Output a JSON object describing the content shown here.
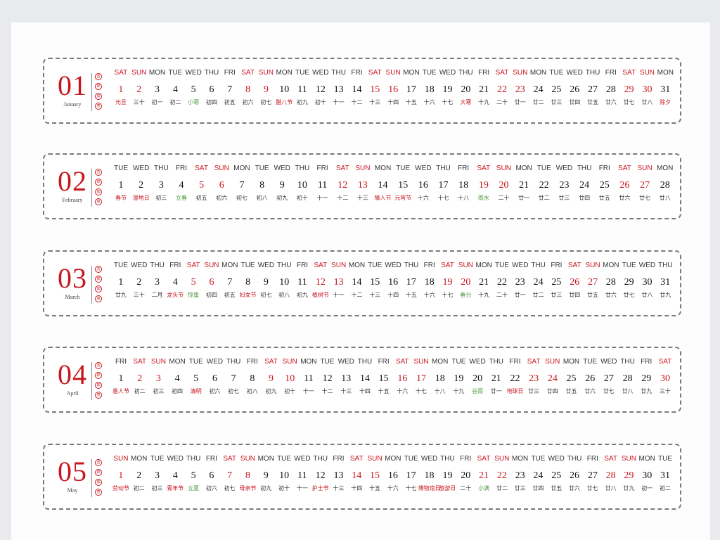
{
  "colors": {
    "accent": "#c8161d",
    "solar_term": "#4a9a3a",
    "text": "#111111",
    "border": "#7a7a7a"
  },
  "seal_text": [
    "吉",
    "祥",
    "如",
    "意"
  ],
  "months": [
    {
      "number": "01",
      "name": "January",
      "days": [
        {
          "w": "SAT",
          "d": "1",
          "l": "元旦",
          "lt": "fest",
          "we": true
        },
        {
          "w": "SUN",
          "d": "2",
          "l": "三十",
          "we": true
        },
        {
          "w": "MON",
          "d": "3",
          "l": "初一"
        },
        {
          "w": "TUE",
          "d": "4",
          "l": "初二"
        },
        {
          "w": "WED",
          "d": "5",
          "l": "小寒",
          "lt": "term"
        },
        {
          "w": "THU",
          "d": "6",
          "l": "初四"
        },
        {
          "w": "FRI",
          "d": "7",
          "l": "初五"
        },
        {
          "w": "SAT",
          "d": "8",
          "l": "初六",
          "we": true
        },
        {
          "w": "SUN",
          "d": "9",
          "l": "初七",
          "we": true
        },
        {
          "w": "MON",
          "d": "10",
          "l": "腊八节",
          "lt": "fest"
        },
        {
          "w": "TUE",
          "d": "11",
          "l": "初九"
        },
        {
          "w": "WED",
          "d": "12",
          "l": "初十"
        },
        {
          "w": "THU",
          "d": "13",
          "l": "十一"
        },
        {
          "w": "FRI",
          "d": "14",
          "l": "十二"
        },
        {
          "w": "SAT",
          "d": "15",
          "l": "十三",
          "we": true
        },
        {
          "w": "SUN",
          "d": "16",
          "l": "十四",
          "we": true
        },
        {
          "w": "MON",
          "d": "17",
          "l": "十五"
        },
        {
          "w": "TUE",
          "d": "18",
          "l": "十六"
        },
        {
          "w": "WED",
          "d": "19",
          "l": "十七"
        },
        {
          "w": "THU",
          "d": "20",
          "l": "大寒",
          "lt": "fest"
        },
        {
          "w": "FRI",
          "d": "21",
          "l": "十九"
        },
        {
          "w": "SAT",
          "d": "22",
          "l": "二十",
          "we": true
        },
        {
          "w": "SUN",
          "d": "23",
          "l": "廿一",
          "we": true
        },
        {
          "w": "MON",
          "d": "24",
          "l": "廿二"
        },
        {
          "w": "TUE",
          "d": "25",
          "l": "廿三"
        },
        {
          "w": "WED",
          "d": "26",
          "l": "廿四"
        },
        {
          "w": "THU",
          "d": "27",
          "l": "廿五"
        },
        {
          "w": "FRI",
          "d": "28",
          "l": "廿六"
        },
        {
          "w": "SAT",
          "d": "29",
          "l": "廿七",
          "we": true
        },
        {
          "w": "SUN",
          "d": "30",
          "l": "廿八",
          "we": true
        },
        {
          "w": "MON",
          "d": "31",
          "l": "除夕",
          "lt": "fest"
        }
      ]
    },
    {
      "number": "02",
      "name": "February",
      "days": [
        {
          "w": "TUE",
          "d": "1",
          "l": "春节",
          "lt": "fest"
        },
        {
          "w": "WED",
          "d": "2",
          "l": "湿地日",
          "lt": "fest"
        },
        {
          "w": "THU",
          "d": "3",
          "l": "初三"
        },
        {
          "w": "FRI",
          "d": "4",
          "l": "立春",
          "lt": "term"
        },
        {
          "w": "SAT",
          "d": "5",
          "l": "初五",
          "we": true
        },
        {
          "w": "SUN",
          "d": "6",
          "l": "初六",
          "we": true
        },
        {
          "w": "MON",
          "d": "7",
          "l": "初七"
        },
        {
          "w": "TUE",
          "d": "8",
          "l": "初八"
        },
        {
          "w": "WED",
          "d": "9",
          "l": "初九"
        },
        {
          "w": "THU",
          "d": "10",
          "l": "初十"
        },
        {
          "w": "FRI",
          "d": "11",
          "l": "十一"
        },
        {
          "w": "SAT",
          "d": "12",
          "l": "十二",
          "we": true
        },
        {
          "w": "SUN",
          "d": "13",
          "l": "十三",
          "we": true
        },
        {
          "w": "MON",
          "d": "14",
          "l": "情人节",
          "lt": "fest"
        },
        {
          "w": "TUE",
          "d": "15",
          "l": "元宵节",
          "lt": "fest"
        },
        {
          "w": "WED",
          "d": "16",
          "l": "十六"
        },
        {
          "w": "THU",
          "d": "17",
          "l": "十七"
        },
        {
          "w": "FRI",
          "d": "18",
          "l": "十八"
        },
        {
          "w": "SAT",
          "d": "19",
          "l": "雨水",
          "lt": "term",
          "we": true
        },
        {
          "w": "SUN",
          "d": "20",
          "l": "二十",
          "we": true
        },
        {
          "w": "MON",
          "d": "21",
          "l": "廿一"
        },
        {
          "w": "TUE",
          "d": "22",
          "l": "廿二"
        },
        {
          "w": "WED",
          "d": "23",
          "l": "廿三"
        },
        {
          "w": "THU",
          "d": "24",
          "l": "廿四"
        },
        {
          "w": "FRI",
          "d": "25",
          "l": "廿五"
        },
        {
          "w": "SAT",
          "d": "26",
          "l": "廿六",
          "we": true
        },
        {
          "w": "SUN",
          "d": "27",
          "l": "廿七",
          "we": true
        },
        {
          "w": "MON",
          "d": "28",
          "l": "廿八"
        }
      ]
    },
    {
      "number": "03",
      "name": "March",
      "days": [
        {
          "w": "TUE",
          "d": "1",
          "l": "廿九"
        },
        {
          "w": "WED",
          "d": "2",
          "l": "三十"
        },
        {
          "w": "THU",
          "d": "3",
          "l": "二月"
        },
        {
          "w": "FRI",
          "d": "4",
          "l": "龙头节",
          "lt": "fest"
        },
        {
          "w": "SAT",
          "d": "5",
          "l": "惊蛰",
          "lt": "term",
          "we": true
        },
        {
          "w": "SUN",
          "d": "6",
          "l": "初四",
          "we": true
        },
        {
          "w": "MON",
          "d": "7",
          "l": "初五"
        },
        {
          "w": "TUE",
          "d": "8",
          "l": "妇女节",
          "lt": "fest"
        },
        {
          "w": "WED",
          "d": "9",
          "l": "初七"
        },
        {
          "w": "THU",
          "d": "10",
          "l": "初八"
        },
        {
          "w": "FRI",
          "d": "11",
          "l": "初九"
        },
        {
          "w": "SAT",
          "d": "12",
          "l": "植树节",
          "lt": "fest",
          "we": true
        },
        {
          "w": "SUN",
          "d": "13",
          "l": "十一",
          "we": true
        },
        {
          "w": "MON",
          "d": "14",
          "l": "十二"
        },
        {
          "w": "TUE",
          "d": "15",
          "l": "十三"
        },
        {
          "w": "WED",
          "d": "16",
          "l": "十四"
        },
        {
          "w": "THU",
          "d": "17",
          "l": "十五"
        },
        {
          "w": "FRI",
          "d": "18",
          "l": "十六"
        },
        {
          "w": "SAT",
          "d": "19",
          "l": "十七",
          "we": true
        },
        {
          "w": "SUN",
          "d": "20",
          "l": "春分",
          "lt": "term",
          "we": true
        },
        {
          "w": "MON",
          "d": "21",
          "l": "十九"
        },
        {
          "w": "TUE",
          "d": "22",
          "l": "二十"
        },
        {
          "w": "WED",
          "d": "23",
          "l": "廿一"
        },
        {
          "w": "THU",
          "d": "24",
          "l": "廿二"
        },
        {
          "w": "FRI",
          "d": "25",
          "l": "廿三"
        },
        {
          "w": "SAT",
          "d": "26",
          "l": "廿四",
          "we": true
        },
        {
          "w": "SUN",
          "d": "27",
          "l": "廿五",
          "we": true
        },
        {
          "w": "MON",
          "d": "28",
          "l": "廿六"
        },
        {
          "w": "TUE",
          "d": "29",
          "l": "廿七"
        },
        {
          "w": "WED",
          "d": "30",
          "l": "廿八"
        },
        {
          "w": "THU",
          "d": "31",
          "l": "廿九"
        }
      ]
    },
    {
      "number": "04",
      "name": "April",
      "days": [
        {
          "w": "FRI",
          "d": "1",
          "l": "愚人节",
          "lt": "fest"
        },
        {
          "w": "SAT",
          "d": "2",
          "l": "初二",
          "we": true
        },
        {
          "w": "SUN",
          "d": "3",
          "l": "初三",
          "we": true
        },
        {
          "w": "MON",
          "d": "4",
          "l": "初四"
        },
        {
          "w": "TUE",
          "d": "5",
          "l": "清明",
          "lt": "fest"
        },
        {
          "w": "WED",
          "d": "6",
          "l": "初六"
        },
        {
          "w": "THU",
          "d": "7",
          "l": "初七"
        },
        {
          "w": "FRI",
          "d": "8",
          "l": "初八"
        },
        {
          "w": "SAT",
          "d": "9",
          "l": "初九",
          "we": true
        },
        {
          "w": "SUN",
          "d": "10",
          "l": "初十",
          "we": true
        },
        {
          "w": "MON",
          "d": "11",
          "l": "十一"
        },
        {
          "w": "TUE",
          "d": "12",
          "l": "十二"
        },
        {
          "w": "WED",
          "d": "13",
          "l": "十三"
        },
        {
          "w": "THU",
          "d": "14",
          "l": "十四"
        },
        {
          "w": "FRI",
          "d": "15",
          "l": "十五"
        },
        {
          "w": "SAT",
          "d": "16",
          "l": "十六",
          "we": true
        },
        {
          "w": "SUN",
          "d": "17",
          "l": "十七",
          "we": true
        },
        {
          "w": "MON",
          "d": "18",
          "l": "十八"
        },
        {
          "w": "TUE",
          "d": "19",
          "l": "十九"
        },
        {
          "w": "WED",
          "d": "20",
          "l": "谷雨",
          "lt": "term"
        },
        {
          "w": "THU",
          "d": "21",
          "l": "廿一"
        },
        {
          "w": "FRI",
          "d": "22",
          "l": "地球日",
          "lt": "fest"
        },
        {
          "w": "SAT",
          "d": "23",
          "l": "廿三",
          "we": true
        },
        {
          "w": "SUN",
          "d": "24",
          "l": "廿四",
          "we": true
        },
        {
          "w": "MON",
          "d": "25",
          "l": "廿五"
        },
        {
          "w": "TUE",
          "d": "26",
          "l": "廿六"
        },
        {
          "w": "WED",
          "d": "27",
          "l": "廿七"
        },
        {
          "w": "THU",
          "d": "28",
          "l": "廿八"
        },
        {
          "w": "FRI",
          "d": "29",
          "l": "廿九"
        },
        {
          "w": "SAT",
          "d": "30",
          "l": "三十",
          "we": true
        }
      ]
    },
    {
      "number": "05",
      "name": "May",
      "days": [
        {
          "w": "SUN",
          "d": "1",
          "l": "劳动节",
          "lt": "fest",
          "we": true
        },
        {
          "w": "MON",
          "d": "2",
          "l": "初二"
        },
        {
          "w": "TUE",
          "d": "3",
          "l": "初三"
        },
        {
          "w": "WED",
          "d": "4",
          "l": "青年节",
          "lt": "fest"
        },
        {
          "w": "THU",
          "d": "5",
          "l": "立夏",
          "lt": "term"
        },
        {
          "w": "FRI",
          "d": "6",
          "l": "初六"
        },
        {
          "w": "SAT",
          "d": "7",
          "l": "初七",
          "we": true
        },
        {
          "w": "SUN",
          "d": "8",
          "l": "母亲节",
          "lt": "fest",
          "we": true
        },
        {
          "w": "MON",
          "d": "9",
          "l": "初九"
        },
        {
          "w": "TUE",
          "d": "10",
          "l": "初十"
        },
        {
          "w": "WED",
          "d": "11",
          "l": "十一"
        },
        {
          "w": "THU",
          "d": "12",
          "l": "护士节",
          "lt": "fest"
        },
        {
          "w": "FRI",
          "d": "13",
          "l": "十三"
        },
        {
          "w": "SAT",
          "d": "14",
          "l": "十四",
          "we": true
        },
        {
          "w": "SUN",
          "d": "15",
          "l": "十五",
          "we": true
        },
        {
          "w": "MON",
          "d": "16",
          "l": "十六"
        },
        {
          "w": "TUE",
          "d": "17",
          "l": "十七"
        },
        {
          "w": "WED",
          "d": "18",
          "l": "博物馆日",
          "lt": "fest"
        },
        {
          "w": "THU",
          "d": "19",
          "l": "旅游日",
          "lt": "fest"
        },
        {
          "w": "FRI",
          "d": "20",
          "l": "二十"
        },
        {
          "w": "SAT",
          "d": "21",
          "l": "小满",
          "lt": "term",
          "we": true
        },
        {
          "w": "SUN",
          "d": "22",
          "l": "廿二",
          "we": true
        },
        {
          "w": "MON",
          "d": "23",
          "l": "廿三"
        },
        {
          "w": "TUE",
          "d": "24",
          "l": "廿四"
        },
        {
          "w": "WED",
          "d": "25",
          "l": "廿五"
        },
        {
          "w": "THU",
          "d": "26",
          "l": "廿六"
        },
        {
          "w": "FRI",
          "d": "27",
          "l": "廿七"
        },
        {
          "w": "SAT",
          "d": "28",
          "l": "廿八",
          "we": true
        },
        {
          "w": "SUN",
          "d": "29",
          "l": "廿九",
          "we": true
        },
        {
          "w": "MON",
          "d": "30",
          "l": "初一"
        },
        {
          "w": "TUE",
          "d": "31",
          "l": "初二"
        }
      ]
    }
  ]
}
